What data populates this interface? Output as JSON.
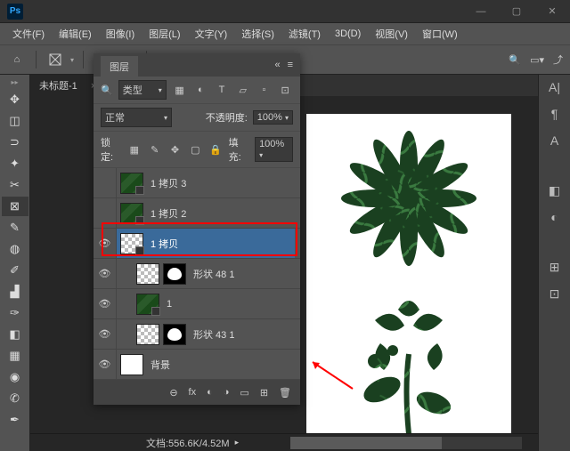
{
  "app": {
    "logo": "Ps"
  },
  "menu": [
    "文件(F)",
    "编辑(E)",
    "图像(I)",
    "图层(L)",
    "文字(Y)",
    "选择(S)",
    "滤镜(T)",
    "3D(D)",
    "视图(V)",
    "窗口(W)"
  ],
  "window_controls": {
    "min": "—",
    "max": "▢",
    "close": "✕"
  },
  "tabs": {
    "doc": "未标题-1",
    "close": "×",
    "collapse": "«"
  },
  "layers": {
    "title": "图层",
    "filter_label": "类型",
    "blend": "正常",
    "opacity_label": "不透明度:",
    "opacity": "100%",
    "lock_label": "锁定:",
    "fill_label": "填充:",
    "fill": "100%",
    "items": [
      {
        "name": "1 拷贝 3",
        "vis": "",
        "thumb": "img",
        "smart": true
      },
      {
        "name": "1 拷贝 2",
        "vis": "",
        "thumb": "img",
        "smart": true
      },
      {
        "name": "1 拷贝",
        "vis": "👁",
        "thumb": "checker",
        "smart": true,
        "selected": true
      },
      {
        "name": "形状 48 1",
        "vis": "👁",
        "thumb": "checker",
        "mask": true,
        "indent": 1
      },
      {
        "name": "1",
        "vis": "👁",
        "thumb": "img",
        "smart": true,
        "indent": 1
      },
      {
        "name": "形状 43 1",
        "vis": "👁",
        "thumb": "checker",
        "mask": true,
        "indent": 1
      },
      {
        "name": "背景",
        "vis": "👁",
        "thumb": "solid"
      }
    ],
    "foot_icons": [
      "⊖",
      "fx",
      "◐",
      "◑",
      "▭",
      "⊞",
      "🗑"
    ]
  },
  "status": {
    "doc": "文档:556.6K/4.52M"
  },
  "right_icons": [
    "A|",
    "¶",
    "A",
    "◧",
    "◐",
    "⊞",
    "⊡"
  ],
  "optbar": {
    "home": "⌂"
  }
}
